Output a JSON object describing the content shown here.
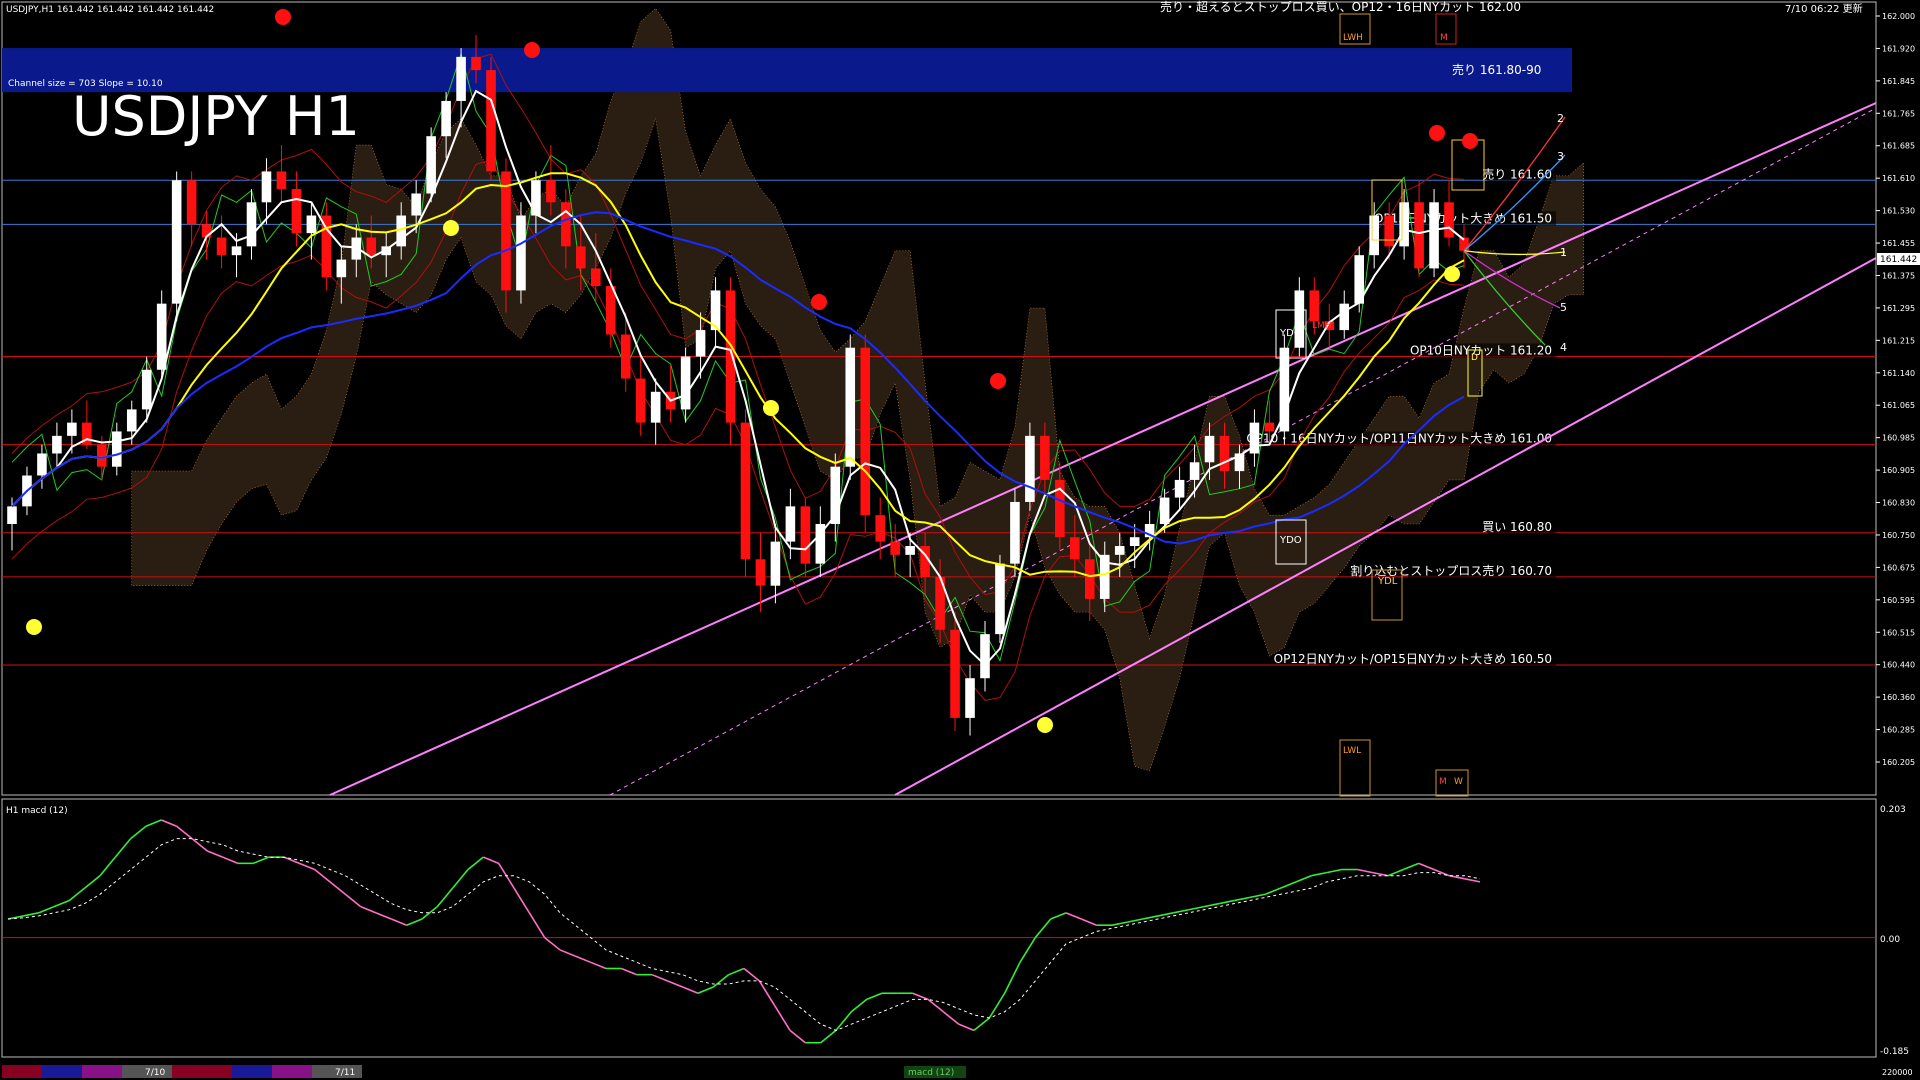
{
  "header": {
    "symbol_info": "USDJPY,H1  161.442 161.442 161.442 161.442",
    "top_note": "売り・超えるとストップロス買い、OP12・16日NYカット 162.00",
    "timestamp": "7/10 06:22 更新",
    "channel_info": "Channel size = 703 Slope = 10.10",
    "title": "USDJPY H1",
    "current_price": "161.442"
  },
  "levels": [
    {
      "price": 161.85,
      "label": "売り 161.80-90",
      "color": "#0a1a8c",
      "kind": "zone"
    },
    {
      "price": 161.6,
      "label": "売り 161.60",
      "color": "#3a7bd5",
      "kind": "line"
    },
    {
      "price": 161.5,
      "label": "OP15日NYカット大きめ 161.50",
      "color": "#3a7bd5",
      "kind": "line"
    },
    {
      "price": 161.2,
      "label": "OP10日NYカット 161.20",
      "color": "#d01010",
      "kind": "line"
    },
    {
      "price": 161.0,
      "label": "OP10・16日NYカット/OP11日NYカット大きめ 161.00",
      "color": "#d01010",
      "kind": "line"
    },
    {
      "price": 160.8,
      "label": "買い 160.80",
      "color": "#d01010",
      "kind": "line"
    },
    {
      "price": 160.7,
      "label": "割り込むとストップロス売り 160.70",
      "color": "#d01010",
      "kind": "line"
    },
    {
      "price": 160.5,
      "label": "OP12日NYカット/OP15日NYカット大きめ 160.50",
      "color": "#d01010",
      "kind": "line"
    }
  ],
  "markers": {
    "ydc": "YDC",
    "ydo": "YDO",
    "ydl": "YDL",
    "lwh": "LWH",
    "lwl": "LWL",
    "m": "M",
    "w": "W",
    "d": "D",
    "lmh": "LMH",
    "fan": [
      "1",
      "2",
      "3",
      "4",
      "5"
    ]
  },
  "price_axis": [
    "162.000",
    "161.920",
    "161.845",
    "161.765",
    "161.685",
    "161.610",
    "161.530",
    "161.455",
    "161.375",
    "161.295",
    "161.215",
    "161.140",
    "161.065",
    "160.985",
    "160.905",
    "160.830",
    "160.750",
    "160.675",
    "160.595",
    "160.515",
    "160.440",
    "160.360",
    "160.285",
    "160.205"
  ],
  "macd": {
    "label": "H1  macd (12)",
    "axis": [
      "0.203",
      "0.00",
      "-0.185"
    ],
    "range": [
      -0.185,
      0.203
    ]
  },
  "bottom_bar": {
    "date1": "7/10",
    "date2": "7/11",
    "mid_label": "macd (12)",
    "right_label": "220000"
  },
  "chart_data": {
    "type": "candlestick",
    "title": "USDJPY H1",
    "ylim": [
      160.205,
      162.0
    ],
    "colors": {
      "bull": "#ffffff",
      "bear": "#ff1010",
      "ma_fast": "#ffffff",
      "ma_mid": "#ffff00",
      "ma_slow": "#1a2cff",
      "channel": "#ff80ff",
      "macd_pos": "#33ee33",
      "macd_neg": "#ff6ec7",
      "signal": "#ffffff"
    },
    "candles": [
      [
        160.82,
        160.88,
        160.76,
        160.86
      ],
      [
        160.86,
        160.95,
        160.84,
        160.93
      ],
      [
        160.93,
        161.0,
        160.9,
        160.98
      ],
      [
        160.98,
        161.05,
        160.95,
        161.02
      ],
      [
        161.02,
        161.08,
        160.98,
        161.05
      ],
      [
        161.05,
        161.1,
        160.99,
        161.0
      ],
      [
        161.0,
        161.02,
        160.92,
        160.95
      ],
      [
        160.95,
        161.05,
        160.93,
        161.03
      ],
      [
        161.03,
        161.1,
        161.0,
        161.08
      ],
      [
        161.08,
        161.2,
        161.05,
        161.17
      ],
      [
        161.17,
        161.35,
        161.15,
        161.32
      ],
      [
        161.32,
        161.62,
        161.28,
        161.6
      ],
      [
        161.6,
        161.62,
        161.45,
        161.5
      ],
      [
        161.5,
        161.53,
        161.42,
        161.47
      ],
      [
        161.47,
        161.52,
        161.4,
        161.43
      ],
      [
        161.43,
        161.48,
        161.38,
        161.45
      ],
      [
        161.45,
        161.58,
        161.42,
        161.55
      ],
      [
        161.55,
        161.65,
        161.5,
        161.62
      ],
      [
        161.62,
        161.68,
        161.55,
        161.58
      ],
      [
        161.58,
        161.62,
        161.45,
        161.48
      ],
      [
        161.48,
        161.55,
        161.42,
        161.52
      ],
      [
        161.52,
        161.55,
        161.35,
        161.38
      ],
      [
        161.38,
        161.45,
        161.32,
        161.42
      ],
      [
        161.42,
        161.5,
        161.38,
        161.47
      ],
      [
        161.47,
        161.52,
        161.4,
        161.43
      ],
      [
        161.43,
        161.48,
        161.38,
        161.45
      ],
      [
        161.45,
        161.55,
        161.42,
        161.52
      ],
      [
        161.52,
        161.6,
        161.48,
        161.57
      ],
      [
        161.57,
        161.72,
        161.55,
        161.7
      ],
      [
        161.7,
        161.8,
        161.65,
        161.78
      ],
      [
        161.78,
        161.9,
        161.72,
        161.88
      ],
      [
        161.88,
        161.93,
        161.82,
        161.85
      ],
      [
        161.85,
        161.88,
        161.6,
        161.62
      ],
      [
        161.62,
        161.65,
        161.3,
        161.35
      ],
      [
        161.35,
        161.55,
        161.32,
        161.52
      ],
      [
        161.52,
        161.62,
        161.48,
        161.6
      ],
      [
        161.6,
        161.68,
        161.52,
        161.55
      ],
      [
        161.55,
        161.58,
        161.4,
        161.45
      ],
      [
        161.45,
        161.52,
        161.35,
        161.4
      ],
      [
        161.4,
        161.48,
        161.32,
        161.36
      ],
      [
        161.36,
        161.4,
        161.22,
        161.25
      ],
      [
        161.25,
        161.3,
        161.12,
        161.15
      ],
      [
        161.15,
        161.2,
        161.02,
        161.05
      ],
      [
        161.05,
        161.15,
        161.0,
        161.12
      ],
      [
        161.12,
        161.18,
        161.05,
        161.08
      ],
      [
        161.08,
        161.22,
        161.05,
        161.2
      ],
      [
        161.2,
        161.3,
        161.15,
        161.26
      ],
      [
        161.26,
        161.38,
        161.22,
        161.35
      ],
      [
        161.35,
        161.38,
        161.0,
        161.05
      ],
      [
        161.05,
        161.08,
        160.7,
        160.74
      ],
      [
        160.74,
        160.8,
        160.62,
        160.68
      ],
      [
        160.68,
        160.82,
        160.64,
        160.78
      ],
      [
        160.78,
        160.9,
        160.74,
        160.86
      ],
      [
        160.86,
        160.88,
        160.7,
        160.73
      ],
      [
        160.73,
        160.86,
        160.7,
        160.82
      ],
      [
        160.82,
        160.98,
        160.78,
        160.95
      ],
      [
        160.95,
        161.25,
        160.92,
        161.22
      ],
      [
        161.22,
        161.25,
        160.8,
        160.84
      ],
      [
        160.84,
        160.88,
        160.74,
        160.78
      ],
      [
        160.78,
        160.82,
        160.7,
        160.75
      ],
      [
        160.75,
        160.8,
        160.7,
        160.77
      ],
      [
        160.77,
        160.8,
        160.66,
        160.7
      ],
      [
        160.7,
        160.74,
        160.55,
        160.58
      ],
      [
        160.58,
        160.62,
        160.35,
        160.38
      ],
      [
        160.38,
        160.5,
        160.34,
        160.47
      ],
      [
        160.47,
        160.6,
        160.44,
        160.57
      ],
      [
        160.57,
        160.75,
        160.55,
        160.73
      ],
      [
        160.73,
        160.9,
        160.7,
        160.87
      ],
      [
        160.87,
        161.05,
        160.85,
        161.02
      ],
      [
        161.02,
        161.05,
        160.88,
        160.92
      ],
      [
        160.92,
        160.96,
        160.76,
        160.79
      ],
      [
        160.79,
        160.84,
        160.7,
        160.74
      ],
      [
        160.74,
        160.78,
        160.6,
        160.65
      ],
      [
        160.65,
        160.78,
        160.62,
        160.75
      ],
      [
        160.75,
        160.8,
        160.7,
        160.77
      ],
      [
        160.77,
        160.82,
        160.72,
        160.79
      ],
      [
        160.79,
        160.85,
        160.76,
        160.82
      ],
      [
        160.82,
        160.9,
        160.8,
        160.88
      ],
      [
        160.88,
        160.95,
        160.85,
        160.92
      ],
      [
        160.92,
        161.0,
        160.88,
        160.96
      ],
      [
        160.96,
        161.05,
        160.92,
        161.02
      ],
      [
        161.02,
        161.05,
        160.9,
        160.94
      ],
      [
        160.94,
        161.0,
        160.9,
        160.98
      ],
      [
        160.98,
        161.08,
        160.95,
        161.05
      ],
      [
        161.05,
        161.1,
        161.0,
        161.03
      ],
      [
        161.03,
        161.25,
        161.0,
        161.22
      ],
      [
        161.22,
        161.38,
        161.2,
        161.35
      ],
      [
        161.35,
        161.38,
        161.25,
        161.28
      ],
      [
        161.28,
        161.32,
        161.22,
        161.26
      ],
      [
        161.26,
        161.35,
        161.24,
        161.32
      ],
      [
        161.32,
        161.45,
        161.3,
        161.43
      ],
      [
        161.43,
        161.55,
        161.4,
        161.52
      ],
      [
        161.52,
        161.55,
        161.42,
        161.45
      ],
      [
        161.45,
        161.58,
        161.42,
        161.55
      ],
      [
        161.55,
        161.6,
        161.38,
        161.4
      ],
      [
        161.4,
        161.58,
        161.38,
        161.55
      ],
      [
        161.55,
        161.6,
        161.45,
        161.47
      ],
      [
        161.47,
        161.5,
        161.4,
        161.44
      ]
    ],
    "macd": [
      0.03,
      0.035,
      0.04,
      0.05,
      0.06,
      0.08,
      0.1,
      0.13,
      0.16,
      0.18,
      0.19,
      0.18,
      0.16,
      0.14,
      0.13,
      0.12,
      0.12,
      0.13,
      0.13,
      0.12,
      0.11,
      0.09,
      0.07,
      0.05,
      0.04,
      0.03,
      0.02,
      0.03,
      0.05,
      0.08,
      0.11,
      0.13,
      0.12,
      0.08,
      0.04,
      0.0,
      -0.02,
      -0.03,
      -0.04,
      -0.05,
      -0.05,
      -0.06,
      -0.06,
      -0.07,
      -0.08,
      -0.09,
      -0.08,
      -0.06,
      -0.05,
      -0.07,
      -0.11,
      -0.15,
      -0.17,
      -0.17,
      -0.15,
      -0.12,
      -0.1,
      -0.09,
      -0.09,
      -0.09,
      -0.1,
      -0.12,
      -0.14,
      -0.15,
      -0.13,
      -0.09,
      -0.04,
      0.0,
      0.03,
      0.04,
      0.03,
      0.02,
      0.02,
      0.025,
      0.03,
      0.035,
      0.04,
      0.045,
      0.05,
      0.055,
      0.06,
      0.065,
      0.07,
      0.08,
      0.09,
      0.1,
      0.105,
      0.11,
      0.11,
      0.105,
      0.1,
      0.11,
      0.12,
      0.11,
      0.1,
      0.095,
      0.09
    ],
    "signal": [
      0.03,
      0.032,
      0.035,
      0.04,
      0.045,
      0.055,
      0.07,
      0.09,
      0.11,
      0.13,
      0.15,
      0.16,
      0.16,
      0.155,
      0.15,
      0.14,
      0.135,
      0.13,
      0.13,
      0.125,
      0.12,
      0.11,
      0.1,
      0.085,
      0.07,
      0.055,
      0.045,
      0.04,
      0.04,
      0.05,
      0.07,
      0.09,
      0.1,
      0.1,
      0.09,
      0.07,
      0.04,
      0.02,
      0.0,
      -0.02,
      -0.03,
      -0.04,
      -0.05,
      -0.055,
      -0.06,
      -0.07,
      -0.075,
      -0.075,
      -0.07,
      -0.07,
      -0.08,
      -0.1,
      -0.12,
      -0.14,
      -0.15,
      -0.14,
      -0.13,
      -0.12,
      -0.11,
      -0.1,
      -0.1,
      -0.105,
      -0.115,
      -0.125,
      -0.13,
      -0.12,
      -0.1,
      -0.07,
      -0.04,
      -0.01,
      0.0,
      0.01,
      0.015,
      0.02,
      0.025,
      0.03,
      0.035,
      0.04,
      0.045,
      0.05,
      0.055,
      0.06,
      0.065,
      0.07,
      0.075,
      0.08,
      0.09,
      0.095,
      0.1,
      0.1,
      0.1,
      0.1,
      0.105,
      0.105,
      0.1,
      0.1,
      0.095
    ]
  }
}
